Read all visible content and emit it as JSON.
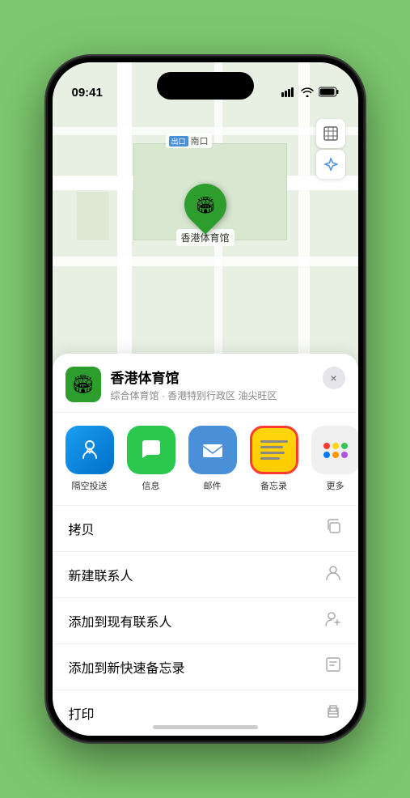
{
  "status_bar": {
    "time": "09:41",
    "signal_icon": "▌▌▌▌",
    "wifi_icon": "wifi",
    "battery_icon": "battery"
  },
  "map": {
    "label_text": "南口",
    "label_badge": "出口"
  },
  "venue": {
    "name": "香港体育馆",
    "subtitle": "综合体育馆 · 香港特别行政区 油尖旺区",
    "pin_label": "香港体育馆",
    "icon_emoji": "🏟"
  },
  "share_items": [
    {
      "id": "airdrop",
      "label": "隔空投送",
      "type": "airdrop"
    },
    {
      "id": "messages",
      "label": "信息",
      "type": "messages"
    },
    {
      "id": "mail",
      "label": "邮件",
      "type": "mail"
    },
    {
      "id": "notes",
      "label": "备忘录",
      "type": "notes"
    },
    {
      "id": "more",
      "label": "更多",
      "type": "more"
    }
  ],
  "actions": [
    {
      "id": "copy",
      "label": "拷贝",
      "icon": "copy"
    },
    {
      "id": "new-contact",
      "label": "新建联系人",
      "icon": "person"
    },
    {
      "id": "add-existing",
      "label": "添加到现有联系人",
      "icon": "person-add"
    },
    {
      "id": "add-notes",
      "label": "添加到新快速备忘录",
      "icon": "note"
    },
    {
      "id": "print",
      "label": "打印",
      "icon": "print"
    }
  ],
  "close_button_label": "×"
}
